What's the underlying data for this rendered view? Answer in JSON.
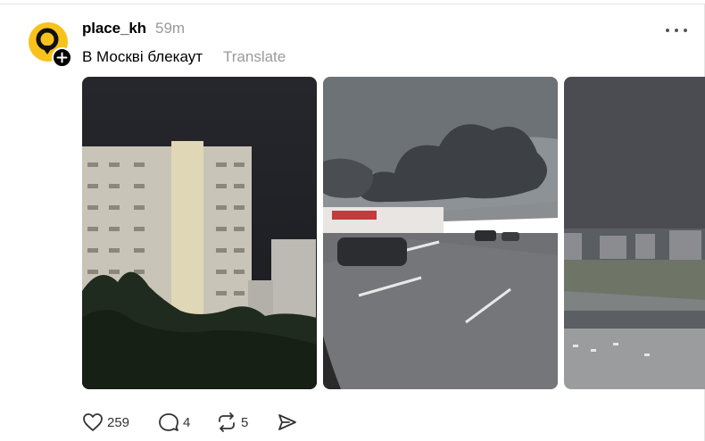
{
  "post": {
    "username": "place_kh",
    "time": "59m",
    "caption": "В Москві блекаут",
    "translate_label": "Translate"
  },
  "actions": {
    "likes": "259",
    "replies": "4",
    "reposts": "5"
  },
  "colors": {
    "avatar_bg": "#f7c21b",
    "secondary_text": "#9a9a9a",
    "icon": "#333333"
  },
  "icons": [
    "more-icon",
    "heart-icon",
    "comment-icon",
    "repost-icon",
    "share-icon",
    "add-follow-icon"
  ]
}
